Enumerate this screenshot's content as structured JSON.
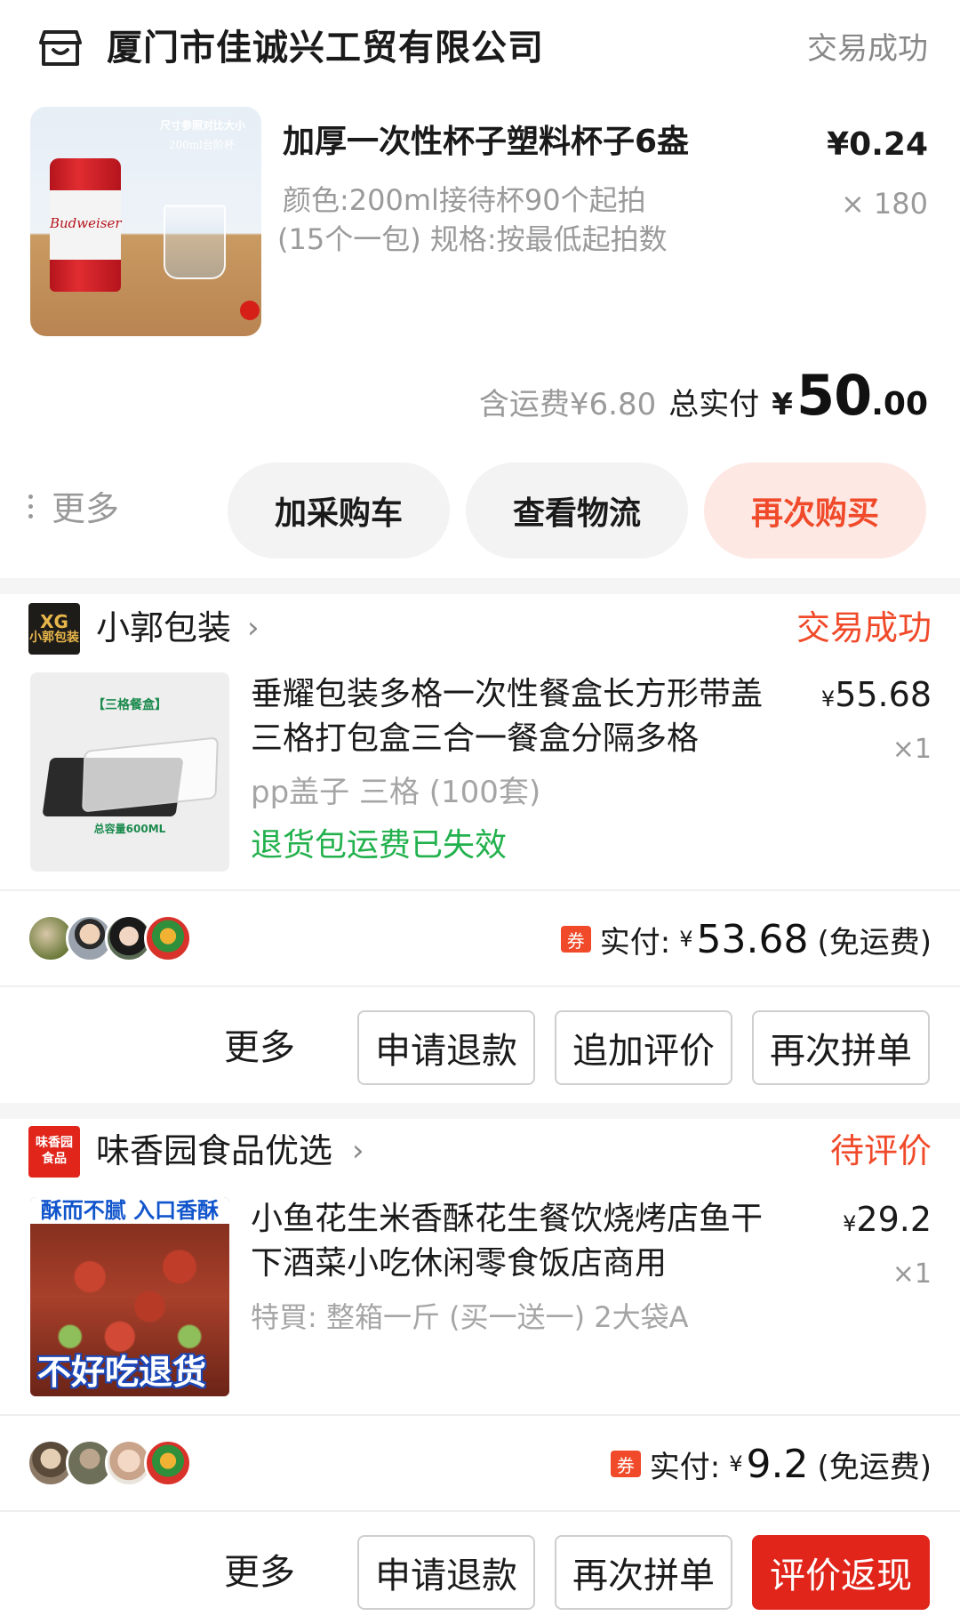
{
  "order1": {
    "shop_name": "厦门市佳诚兴工贸有限公司",
    "status": "交易成功",
    "product": {
      "image_caption_1": "尺寸参照对比大小",
      "image_caption_2": "200ml台阶杯",
      "image_brand": "Budweiser",
      "title": "加厚一次性杯子塑料杯子6盎",
      "price": "¥0.24",
      "spec_line1": "颜色:200ml接待杯90个起拍",
      "spec_line2": "(15个一包) 规格:按最低起拍数",
      "quantity": "× 180"
    },
    "summary": {
      "shipping": "含运费¥6.80",
      "total_label": "总实付",
      "currency": "¥",
      "total_integer": "50",
      "total_decimal": ".00"
    },
    "actions": {
      "more": "更多",
      "add_cart": "加采购车",
      "track": "查看物流",
      "rebuy": "再次购买"
    }
  },
  "order2": {
    "shop_logo_line1": "XG",
    "shop_logo_line2": "小郭包装",
    "shop_name": "小郭包装",
    "status": "交易成功",
    "product": {
      "image_label": "【三格餐盒】",
      "image_caption": "总容量600ML",
      "title": "垂耀包装多格一次性餐盒长方形带盖三格打包盒三合一餐盒分隔多格",
      "price_symbol": "¥",
      "price": "55.68",
      "quantity": "×1",
      "spec": "pp盖子 三格 (100套)",
      "notice": "退货包运费已失效"
    },
    "payment": {
      "coupon": "券",
      "label": "实付:",
      "currency": "¥",
      "amount": "53.68",
      "note": "(免运费)"
    },
    "actions": {
      "more": "更多",
      "refund": "申请退款",
      "add_review": "追加评价",
      "regroup": "再次拼单"
    }
  },
  "order3": {
    "shop_logo_line1": "味香园",
    "shop_logo_line2": "食品",
    "shop_name": "味香园食品优选",
    "status": "待评价",
    "product": {
      "image_top_text": "酥而不腻 入口香酥",
      "image_bottom_text": "不好吃退货",
      "title": "小鱼花生米香酥花生餐饮烧烤店鱼干下酒菜小吃休闲零食饭店商用",
      "price_symbol": "¥",
      "price": "29.2",
      "quantity": "×1",
      "spec": "特買: 整箱一斤 (买一送一) 2大袋A"
    },
    "payment": {
      "coupon": "券",
      "label": "实付:",
      "currency": "¥",
      "amount": "9.2",
      "note": "(免运费)"
    },
    "actions": {
      "more": "更多",
      "refund": "申请退款",
      "regroup": "再次拼单",
      "review_cashback": "评价返现"
    }
  },
  "colors": {
    "accent_red": "#f04a2a",
    "button_red": "#e1251b",
    "success_green": "#22b14c",
    "muted_gray": "#9a9a9a"
  }
}
